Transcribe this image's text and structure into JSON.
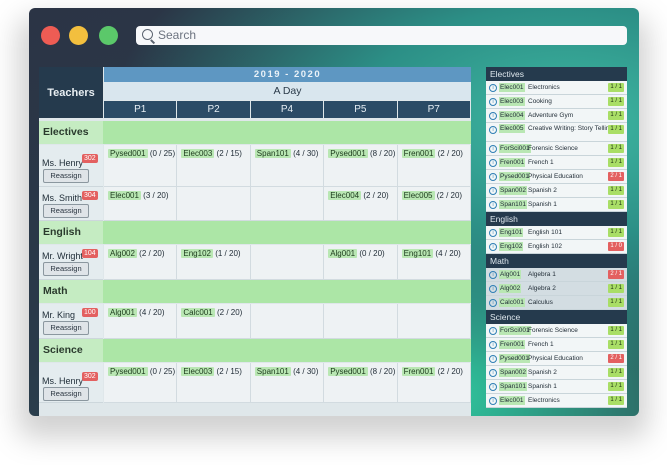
{
  "window": {
    "controls": [
      "close",
      "minimize",
      "maximize"
    ]
  },
  "search": {
    "placeholder": "Search"
  },
  "schedule": {
    "teachers_label": "Teachers",
    "year": "2019 - 2020",
    "day": "A Day",
    "periods": [
      "P1",
      "P2",
      "P4",
      "P5",
      "P7"
    ],
    "reassign_label": "Reassign",
    "sections": [
      {
        "title": "Electives",
        "rows": [
          {
            "teacher": "Ms. Henry",
            "room": "302",
            "courses": [
              {
                "code": "Pysed001",
                "count": "(0 / 25)"
              },
              {
                "code": "Elec003",
                "count": "(2 / 15)"
              },
              {
                "code": "Span101",
                "count": "(4 / 30)"
              },
              {
                "code": "Pysed001",
                "count": "(8 / 20)"
              },
              {
                "code": "Fren001",
                "count": "(2 / 20)"
              }
            ]
          },
          {
            "teacher": "Ms. Smith",
            "room": "304",
            "courses": [
              {
                "code": "Elec001",
                "count": "(3 / 20)"
              },
              {
                "code": "",
                "count": ""
              },
              {
                "code": "",
                "count": ""
              },
              {
                "code": "Elec004",
                "count": "(2 / 20)"
              },
              {
                "code": "Elec005",
                "count": "(2 / 20)"
              }
            ]
          }
        ]
      },
      {
        "title": "English",
        "rows": [
          {
            "teacher": "Mr. Wright",
            "room": "104",
            "courses": [
              {
                "code": "Alg002",
                "count": "(2 / 20)"
              },
              {
                "code": "Eng102",
                "count": "(1 / 20)"
              },
              {
                "code": "",
                "count": ""
              },
              {
                "code": "Alg001",
                "count": "(0 / 20)"
              },
              {
                "code": "Eng101",
                "count": "(4 / 20)"
              }
            ]
          }
        ]
      },
      {
        "title": "Math",
        "rows": [
          {
            "teacher": "Mr. King",
            "room": "100",
            "courses": [
              {
                "code": "Alg001",
                "count": "(4 / 20)"
              },
              {
                "code": "Calc001",
                "count": "(2 / 20)"
              },
              {
                "code": "",
                "count": ""
              },
              {
                "code": "",
                "count": ""
              },
              {
                "code": "",
                "count": ""
              }
            ]
          }
        ]
      },
      {
        "title": "Science",
        "rows": [
          {
            "teacher": "Ms. Henry",
            "room": "302",
            "courses": [
              {
                "code": "Pysed001",
                "count": "(0 / 25)"
              },
              {
                "code": "Elec003",
                "count": "(2 / 15)"
              },
              {
                "code": "Span101",
                "count": "(4 / 30)"
              },
              {
                "code": "Pysed001",
                "count": "(8 / 20)"
              },
              {
                "code": "Fren001",
                "count": "(2 / 20)"
              }
            ]
          }
        ]
      }
    ]
  },
  "panel": {
    "groups": [
      {
        "title": "Electives",
        "items": [
          {
            "code": "Elec001",
            "name": "Electronics",
            "ratio": "1 / 1",
            "status": "ok"
          },
          {
            "code": "Elec003",
            "name": "Cooking",
            "ratio": "1 / 1",
            "status": "ok"
          },
          {
            "code": "Elec004",
            "name": "Adventure Gym",
            "ratio": "1 / 1",
            "status": "ok"
          },
          {
            "code": "Elec005",
            "name": "Creative Writing: Story Telling",
            "ratio": "1 / 1",
            "status": "ok"
          },
          {
            "code": "ForSci001",
            "name": "Forensic Science",
            "ratio": "1 / 1",
            "status": "ok"
          },
          {
            "code": "Fren001",
            "name": "French 1",
            "ratio": "1 / 1",
            "status": "ok"
          },
          {
            "code": "Pysed001",
            "name": "Physical Education",
            "ratio": "2 / 1",
            "status": "over"
          },
          {
            "code": "Span002",
            "name": "Spanish 2",
            "ratio": "1 / 1",
            "status": "ok"
          },
          {
            "code": "Span101",
            "name": "Spanish 1",
            "ratio": "1 / 1",
            "status": "ok"
          }
        ]
      },
      {
        "title": "English",
        "items": [
          {
            "code": "Eng101",
            "name": "English 101",
            "ratio": "1 / 1",
            "status": "ok"
          },
          {
            "code": "Eng102",
            "name": "English 102",
            "ratio": "1 / 0",
            "status": "over"
          }
        ]
      },
      {
        "title": "Math",
        "items": [
          {
            "code": "Alg001",
            "name": "Algebra 1",
            "ratio": "2 / 1",
            "status": "over"
          },
          {
            "code": "Alg002",
            "name": "Algebra 2",
            "ratio": "1 / 1",
            "status": "ok"
          },
          {
            "code": "Calc001",
            "name": "Calculus",
            "ratio": "1 / 1",
            "status": "ok"
          }
        ]
      },
      {
        "title": "Science",
        "items": [
          {
            "code": "ForSci001",
            "name": "Forensic Science",
            "ratio": "1 / 1",
            "status": "ok"
          },
          {
            "code": "Fren001",
            "name": "French 1",
            "ratio": "1 / 1",
            "status": "ok"
          },
          {
            "code": "Pysed001",
            "name": "Physical Education",
            "ratio": "2 / 1",
            "status": "over"
          },
          {
            "code": "Span002",
            "name": "Spanish 2",
            "ratio": "1 / 1",
            "status": "ok"
          },
          {
            "code": "Span101",
            "name": "Spanish 1",
            "ratio": "1 / 1",
            "status": "ok"
          },
          {
            "code": "Elec001",
            "name": "Electronics",
            "ratio": "1 / 1",
            "status": "ok"
          }
        ]
      }
    ]
  },
  "colors": {
    "accent": "#5e97c2",
    "section_green": "#ace6a6",
    "room_badge": "#e36060",
    "ok_badge": "#a9de66"
  }
}
